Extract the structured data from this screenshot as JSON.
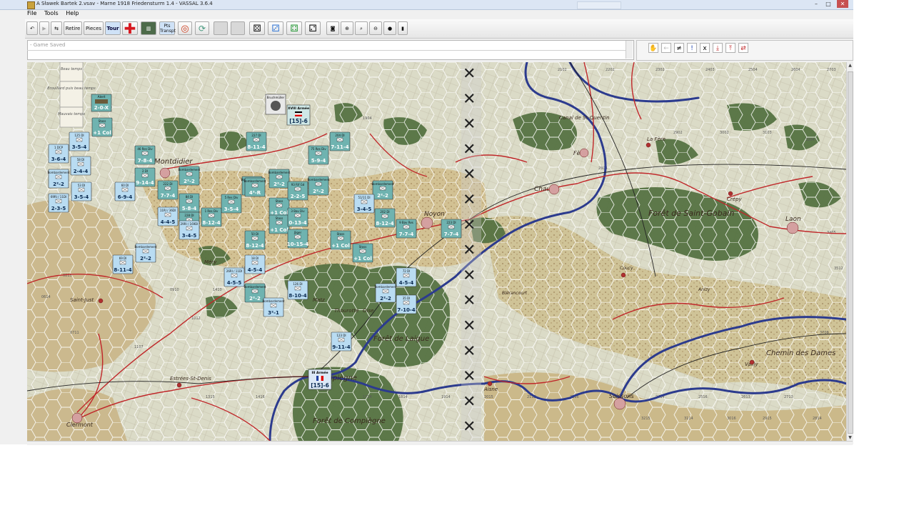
{
  "window": {
    "title": "A Sławek Bartek 2.vsav - Marne 1918 Friedensturm 1.4 - VASSAL 3.6.4",
    "minimize": "–",
    "maximize": "□",
    "close": "✕"
  },
  "menu": [
    "File",
    "Tools",
    "Help"
  ],
  "toolbar": {
    "retire": "Retire",
    "pieces": "Pieces",
    "tour": "Tour",
    "pts_transport_line1": "Pts",
    "pts_transport_line2": "Transpt"
  },
  "chat": {
    "log_line": "- Game Saved"
  },
  "map": {
    "weather_boxes": [
      "Beau temps",
      "Brouillard puis beau temps",
      "Mauvais temps"
    ],
    "places": [
      {
        "name": "Montdidier"
      },
      {
        "name": "Noyon"
      },
      {
        "name": "Chauny"
      },
      {
        "name": "Fère"
      },
      {
        "name": "La Fère"
      },
      {
        "name": "Crépy"
      },
      {
        "name": "Laon"
      },
      {
        "name": "Forêt de Saint-Gobain"
      },
      {
        "name": "Compiègne"
      },
      {
        "name": "Forêt de Laigue"
      },
      {
        "name": "Forêt de Compiègne"
      },
      {
        "name": "Soissons"
      },
      {
        "name": "Chemin des Dames"
      },
      {
        "name": "Saint-Just"
      },
      {
        "name": "Clermont"
      },
      {
        "name": "Estrées-St-Denis"
      },
      {
        "name": "Méry"
      },
      {
        "name": "Vailly"
      },
      {
        "name": "Aisne"
      },
      {
        "name": "Oise"
      },
      {
        "name": "Matz"
      },
      {
        "name": "Thourotte"
      },
      {
        "name": "Canal de St-Quentin"
      },
      {
        "name": "Blérancourt"
      },
      {
        "name": "Coucy"
      },
      {
        "name": "Anizy"
      }
    ],
    "hq_counters": [
      {
        "label": "XVIII Armée",
        "value": "[15]-6",
        "flag": "german"
      },
      {
        "label": "III Armée",
        "value": "[15]-6",
        "flag": "french"
      }
    ],
    "leader_counter": {
      "label": "Bruchmüller"
    },
    "alert_counter": {
      "label": "Alert",
      "value": "2-0-X"
    },
    "counters": [
      {
        "title": "Stoss",
        "value": "+1 Col",
        "side": "de"
      },
      {
        "title": "125 DI",
        "value": "3-5-4",
        "side": "fr"
      },
      {
        "title": "1 DCP",
        "value": "3-6-4",
        "side": "fr"
      },
      {
        "title": "58 DI",
        "value": "2-4-4",
        "side": "fr"
      },
      {
        "title": "Bombardement",
        "value": "2²-2",
        "side": "fr"
      },
      {
        "title": "53 DI",
        "value": "3-5-4",
        "side": "fr"
      },
      {
        "title": "69RI / 11DI",
        "value": "2-3-5",
        "side": "fr"
      },
      {
        "title": "46 Res Div",
        "value": "7-8-4",
        "side": "de"
      },
      {
        "title": "2 DI",
        "value": "9-14-4",
        "side": "de"
      },
      {
        "title": "60 DI",
        "value": "6-9-4",
        "side": "fr"
      },
      {
        "title": "222 DI",
        "value": "7-7-4",
        "side": "de"
      },
      {
        "title": "Bombardement",
        "value": "2²-2",
        "side": "de"
      },
      {
        "title": "84 DI",
        "value": "5-8-4",
        "side": "de"
      },
      {
        "title": "228 DI",
        "value": "8-11-4",
        "side": "de"
      },
      {
        "title": "5 Res Div",
        "value": "3-5-4",
        "side": "de"
      },
      {
        "title": "1 Res Div",
        "value": "8-12-4",
        "side": "de"
      },
      {
        "title": "11RI / 36DI",
        "value": "4-4-5",
        "side": "fr"
      },
      {
        "title": "29RI / 169DI",
        "value": "3-4-5",
        "side": "fr"
      },
      {
        "title": "227 DI",
        "value": "8-11-4",
        "side": "de"
      },
      {
        "title": "Bombardement",
        "value": "2²-2",
        "side": "de"
      },
      {
        "title": "Bombardement",
        "value": "2²-2",
        "side": "de"
      },
      {
        "title": "Stoss",
        "value": "+1 Col",
        "side": "de"
      },
      {
        "title": "Stoss",
        "value": "+1 Col",
        "side": "de"
      },
      {
        "title": "93 Rif Gd",
        "value": "2-2-5",
        "side": "de"
      },
      {
        "title": "3 Bav Div",
        "value": "0-13-4",
        "side": "de"
      },
      {
        "title": "Jäger",
        "value": "10-15-4",
        "side": "de"
      },
      {
        "title": "50 DI",
        "value": "8-12-4",
        "side": "de"
      },
      {
        "title": "Bombardement",
        "value": "4²-R",
        "side": "de"
      },
      {
        "title": "75 Res Div",
        "value": "5-9-4",
        "side": "de"
      },
      {
        "title": "204 DI",
        "value": "7-11-4",
        "side": "de"
      },
      {
        "title": "Bombardement",
        "value": "2²-2",
        "side": "de"
      },
      {
        "title": "Bombardement",
        "value": "2²-2",
        "side": "de"
      },
      {
        "title": "51/11 DI",
        "value": "3-4-5",
        "side": "fr"
      },
      {
        "title": "202 DI",
        "value": "8-12-4",
        "side": "de"
      },
      {
        "title": "Stoss",
        "value": "+1 Col",
        "side": "de"
      },
      {
        "title": "Stoss",
        "value": "+1 Col",
        "side": "de"
      },
      {
        "title": "9 Bav Res",
        "value": "7-7-4",
        "side": "de"
      },
      {
        "title": "223 DI",
        "value": "7-7-4",
        "side": "de"
      },
      {
        "title": "69 DI",
        "value": "8-11-4",
        "side": "fr"
      },
      {
        "title": "Bombardement",
        "value": "2²-2",
        "side": "fr"
      },
      {
        "title": "18 DI",
        "value": "4-5-4",
        "side": "fr"
      },
      {
        "title": "26RI / 11DI",
        "value": "4-5-5",
        "side": "fr"
      },
      {
        "title": "Bombardement",
        "value": "2²-2",
        "side": "de"
      },
      {
        "title": "Bombardement",
        "value": "3²-1",
        "side": "fr"
      },
      {
        "title": "126 DI",
        "value": "8-10-4",
        "side": "fr"
      },
      {
        "title": "72 DI",
        "value": "4-5-4",
        "side": "fr"
      },
      {
        "title": "Bombardement",
        "value": "2²-2",
        "side": "fr"
      },
      {
        "title": "35 DI",
        "value": "7-10-4",
        "side": "fr"
      },
      {
        "title": "123 DI",
        "value": "9-11-4",
        "side": "fr"
      }
    ],
    "blocked_column_marker": "✕",
    "hex_numbers": [
      "2102",
      "2202",
      "2302",
      "2403",
      "2504",
      "2604",
      "2703",
      "2804",
      "2902",
      "3002",
      "3103",
      "3204",
      "3405",
      "3512",
      "3706",
      "1904",
      "1806",
      "1511",
      "1410",
      "0813",
      "0614",
      "0711",
      "0910",
      "1012",
      "1107",
      "1315",
      "1416",
      "1614",
      "1714",
      "1814",
      "1914",
      "2015",
      "2113",
      "2216",
      "2315",
      "2414",
      "2516",
      "2613",
      "2713",
      "2814",
      "2915",
      "3016",
      "3114",
      "3215"
    ]
  },
  "colors": {
    "french_counter": "#b9dcf2",
    "german_counter": "#6fb3b0",
    "river": "#2c3b8e",
    "road": "#c0282a",
    "forest": "#4f6b3d",
    "column_marker": "#222222"
  }
}
